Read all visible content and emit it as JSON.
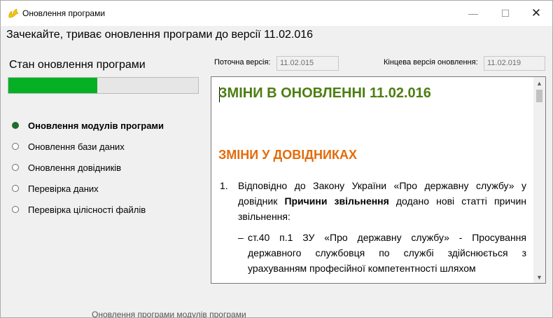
{
  "window": {
    "title": "Оновлення програми",
    "controls": {
      "minimize": "—",
      "maximize": "☐",
      "close": "✕"
    }
  },
  "header": {
    "message": "Зачекайте, триває оновлення програми до версії 11.02.016"
  },
  "progress": {
    "title": "Стан оновлення програми",
    "percent": 47,
    "fill_color": "#06b025"
  },
  "steps": [
    {
      "label": "Оновлення модулів програми",
      "active": true
    },
    {
      "label": "Оновлення бази даних",
      "active": false
    },
    {
      "label": "Оновлення довідників",
      "active": false
    },
    {
      "label": "Перевірка даних",
      "active": false
    },
    {
      "label": "Перевірка цілісності файлів",
      "active": false
    }
  ],
  "versions": {
    "current_label": "Поточна версія:",
    "current_value": "11.02.015",
    "target_label": "Кінцева версія оновлення:",
    "target_value": "11.02.019"
  },
  "document": {
    "heading": "ЗМІНИ В ОНОВЛЕННІ 11.02.016",
    "subheading": "ЗМІНИ У ДОВІДНИКАХ",
    "item_number": "1.",
    "item_text_before": "Відповідно до Закону України «Про державну службу» у довідник ",
    "item_text_bold": "Причини звільнення",
    "item_text_after": " додано нові статті причин звільнення:",
    "sub_dash": "–",
    "sub_text": "ст.40 п.1 ЗУ «Про державну службу» - Просування державного службовця по службі здійснюється з урахуванням професійної компетентності шляхом"
  },
  "scrollbar": {
    "up_icon": "▲",
    "down_icon": "▼"
  },
  "footer": {
    "ghost_text": "Оновлення програми модулів програми"
  },
  "colors": {
    "heading_green": "#4d7e12",
    "heading_orange": "#e36c0a",
    "active_dot": "#1f6d2e"
  }
}
